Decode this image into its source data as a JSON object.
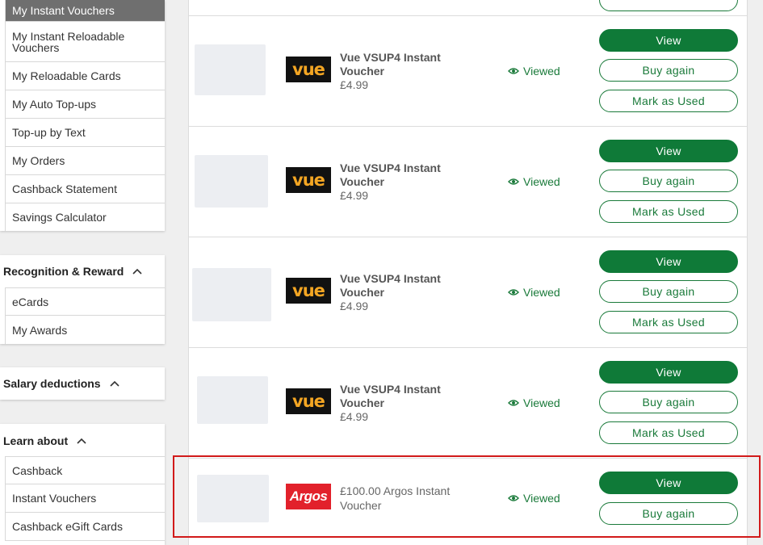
{
  "sidebar": {
    "account_items": [
      {
        "label": "My Instant Vouchers",
        "active": true
      },
      {
        "label": "My Instant Reloadable Vouchers"
      },
      {
        "label": "My Reloadable Cards"
      },
      {
        "label": "My Auto Top-ups"
      },
      {
        "label": "Top-up by Text"
      },
      {
        "label": "My Orders"
      },
      {
        "label": "Cashback Statement"
      },
      {
        "label": "Savings Calculator"
      }
    ],
    "recognition": {
      "title": "Recognition & Reward",
      "items": [
        {
          "label": "eCards"
        },
        {
          "label": "My Awards"
        }
      ]
    },
    "salary": {
      "title": "Salary deductions"
    },
    "learn": {
      "title": "Learn about",
      "items": [
        {
          "label": "Cashback"
        },
        {
          "label": "Instant Vouchers"
        },
        {
          "label": "Cashback eGift Cards"
        }
      ]
    }
  },
  "vouchers": [
    {
      "brand": "vue",
      "brand_logo_text": "vue",
      "title": "Vue VSUP4 Instant Voucher",
      "price": "£4.99",
      "status": "Viewed",
      "buttons": {
        "view": "View",
        "buy_again": "Buy again",
        "mark_used": "Mark as Used"
      }
    },
    {
      "brand": "vue",
      "brand_logo_text": "vue",
      "title": "Vue VSUP4 Instant Voucher",
      "price": "£4.99",
      "status": "Viewed",
      "buttons": {
        "view": "View",
        "buy_again": "Buy again",
        "mark_used": "Mark as Used"
      }
    },
    {
      "brand": "vue",
      "brand_logo_text": "vue",
      "title": "Vue VSUP4 Instant Voucher",
      "price": "£4.99",
      "status": "Viewed",
      "buttons": {
        "view": "View",
        "buy_again": "Buy again",
        "mark_used": "Mark as Used"
      }
    },
    {
      "brand": "vue",
      "brand_logo_text": "vue",
      "title": "Vue VSUP4 Instant Voucher",
      "price": "£4.99",
      "status": "Viewed",
      "buttons": {
        "view": "View",
        "buy_again": "Buy again",
        "mark_used": "Mark as Used"
      }
    },
    {
      "brand": "argos",
      "brand_logo_text": "Argos",
      "title": "£100.00 Argos Instant Voucher",
      "status": "Viewed",
      "buttons": {
        "view": "View",
        "buy_again": "Buy again"
      }
    }
  ],
  "colors": {
    "accent": "#0f7a38",
    "active_menu": "#6f6f6f",
    "highlight": "#d11a1a"
  },
  "icons": {
    "status": "eye-icon",
    "section_toggle": "chevron-up-icon"
  }
}
